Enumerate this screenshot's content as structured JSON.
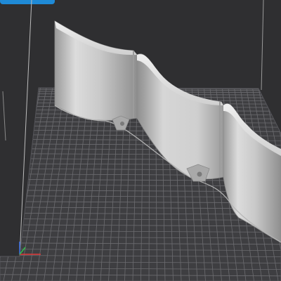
{
  "viewport": {
    "background": "#2f2f31",
    "plate_color": "#3e3e41",
    "grid_color": "#6c6c70",
    "model_color": "#c8c8c8",
    "accent_tab_color": "#1f8ad6"
  },
  "toolbar": {
    "active_tab_indicator": "top-left-tab"
  },
  "axis_gizmo": {
    "x_color": "#e23a3a",
    "y_color": "#2fbf4a",
    "z_color": "#3a6fe2"
  },
  "model": {
    "type": "scalloped-wall",
    "segments": 3,
    "connectors": 2
  }
}
